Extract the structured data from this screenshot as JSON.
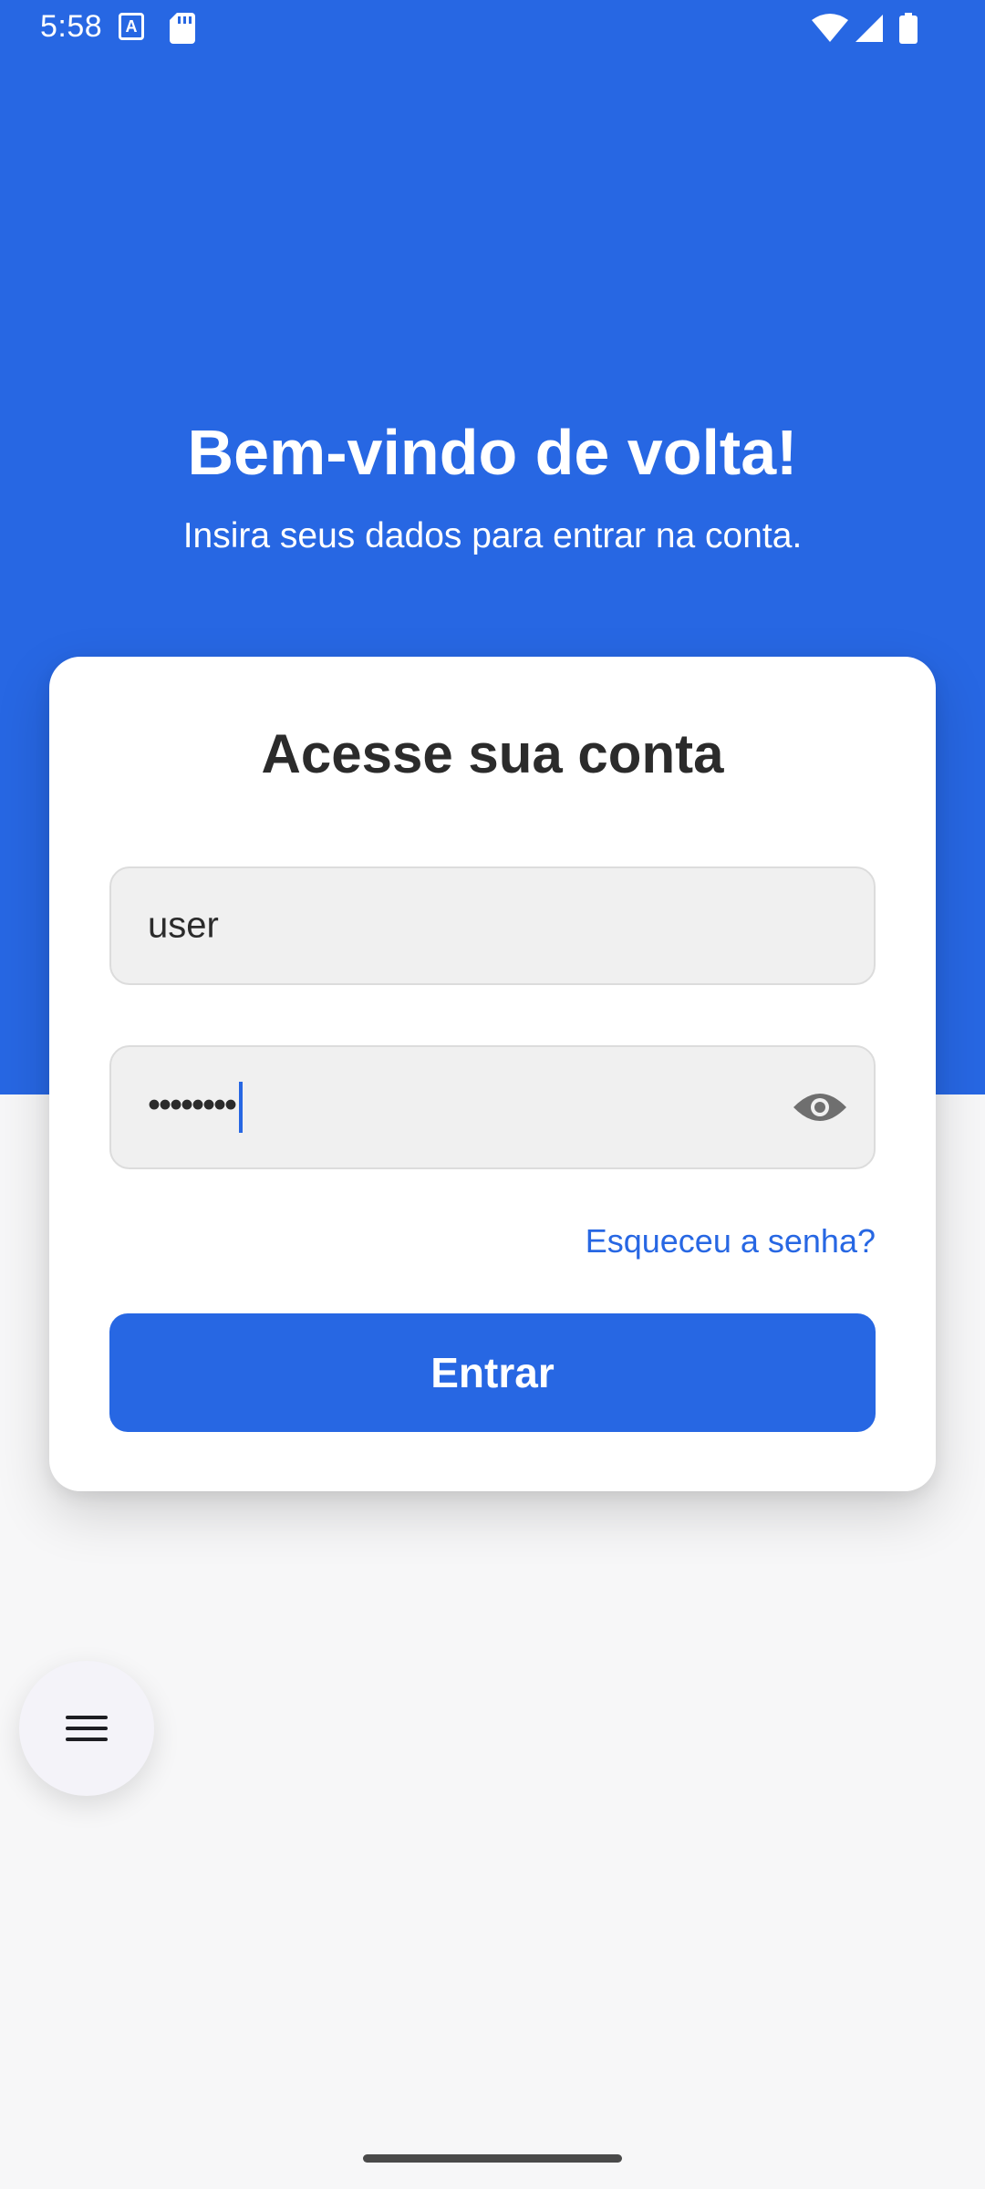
{
  "status_bar": {
    "time": "5:58",
    "icons": [
      "accessibility-a-icon",
      "sd-card-icon",
      "wifi-icon",
      "signal-icon",
      "battery-icon"
    ]
  },
  "colors": {
    "primary": "#2767e3",
    "background": "#f7f7f8",
    "card": "#ffffff",
    "field": "#f0f0f0",
    "title_text": "#2b2b2b"
  },
  "hero": {
    "title": "Bem-vindo de volta!",
    "subtitle": "Insira seus dados para entrar na conta."
  },
  "login_card": {
    "title": "Acesse sua conta",
    "username_value": "user",
    "password_value": "••••••••",
    "toggle_icon": "eye-icon",
    "forgot_password_label": "Esqueceu a senha?",
    "submit_label": "Entrar"
  },
  "fab": {
    "icon": "menu-icon"
  }
}
